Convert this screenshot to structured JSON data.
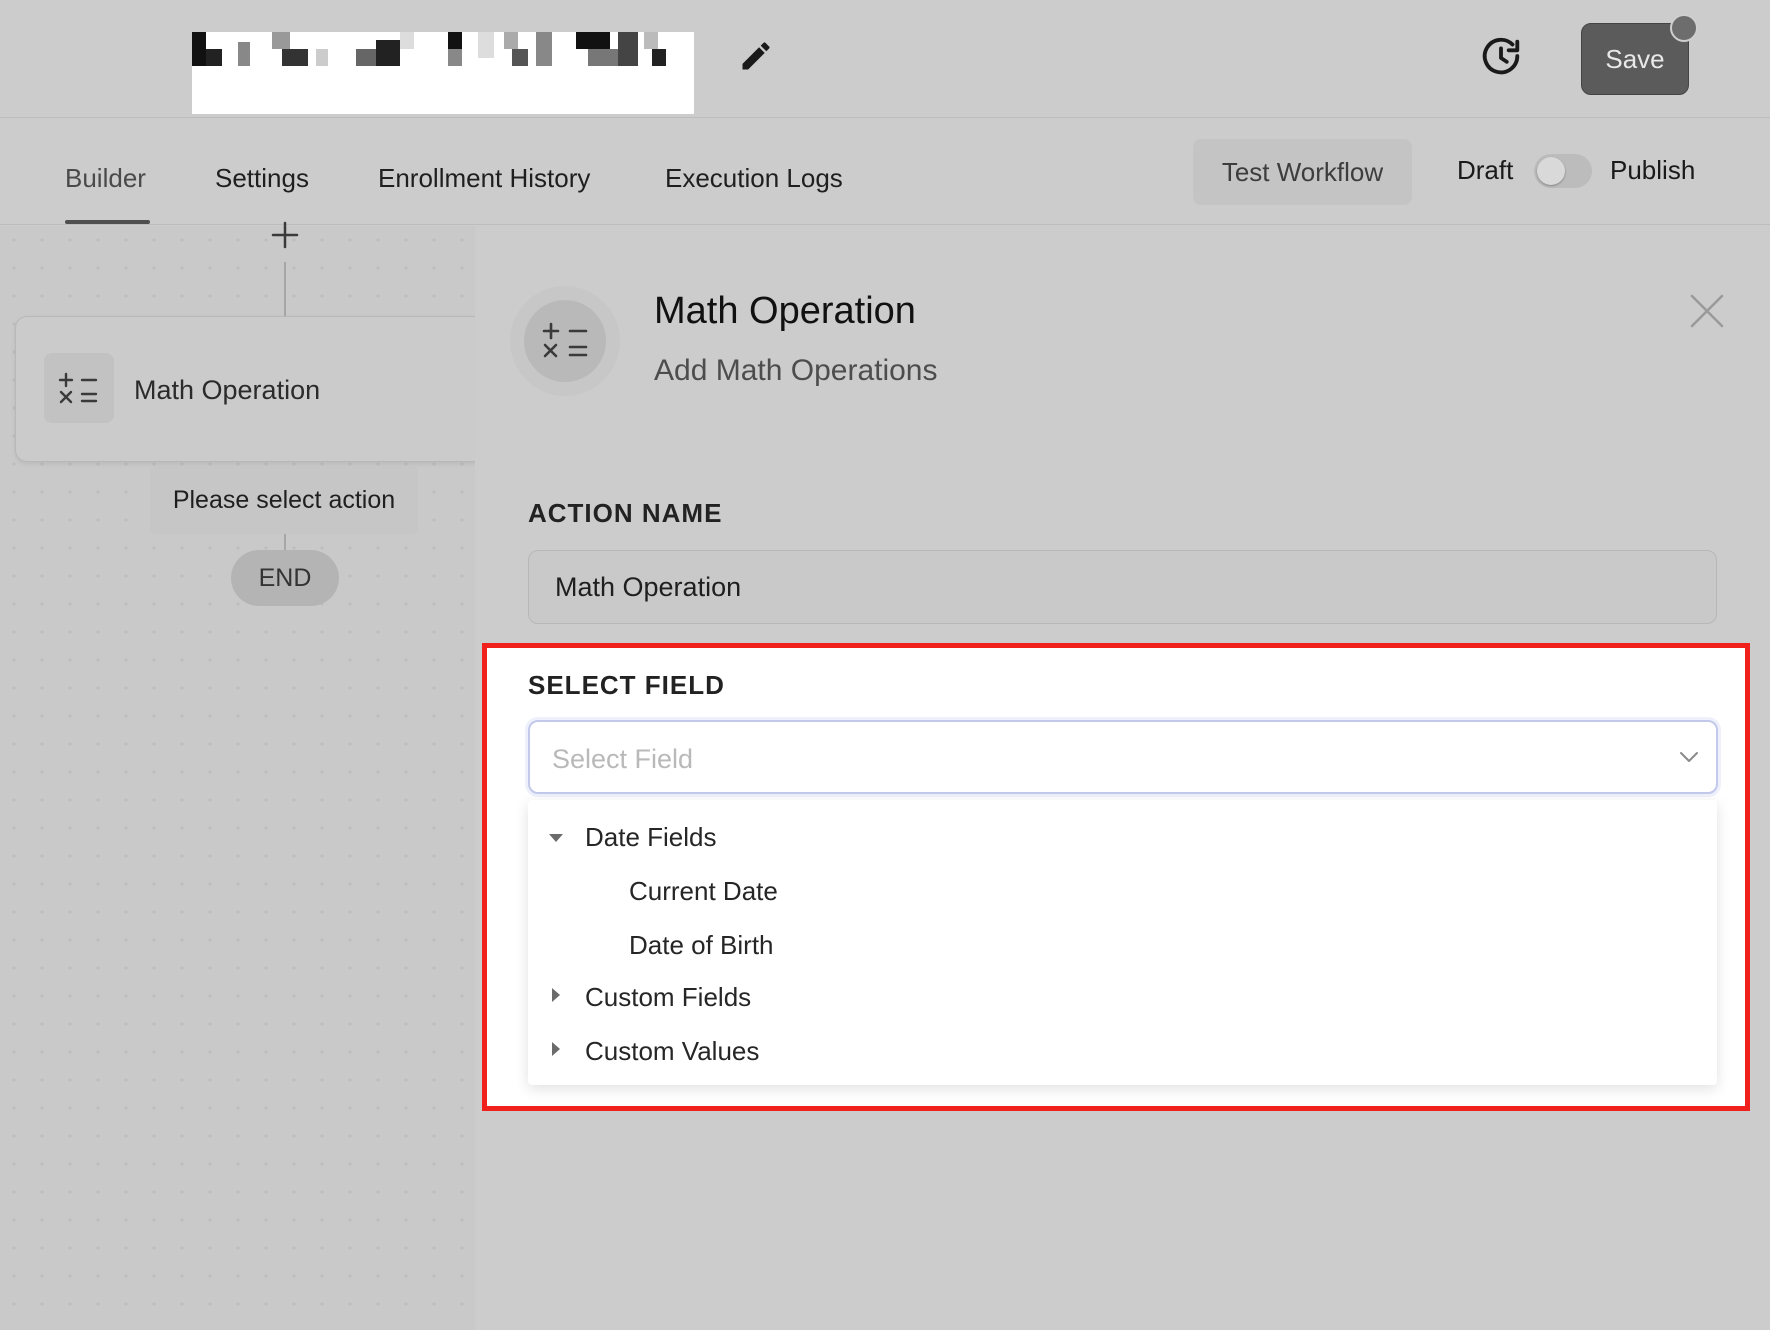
{
  "topbar": {
    "save_label": "Save"
  },
  "tabs": [
    {
      "label": "Builder",
      "active": true
    },
    {
      "label": "Settings",
      "active": false
    },
    {
      "label": "Enrollment History",
      "active": false
    },
    {
      "label": "Execution Logs",
      "active": false
    }
  ],
  "toolbar": {
    "test_workflow_label": "Test Workflow",
    "draft_label": "Draft",
    "publish_label": "Publish",
    "publish_toggle_on": false
  },
  "canvas": {
    "node_label": "Math Operation",
    "action_hint": "Please select action",
    "end_label": "END"
  },
  "panel": {
    "title": "Math Operation",
    "subtitle": "Add Math Operations",
    "action_name_label": "ACTION NAME",
    "action_name_value": "Math Operation",
    "select_field_label": "SELECT FIELD",
    "select_field_placeholder": "Select Field",
    "dropdown": {
      "groups": [
        {
          "label": "Date Fields",
          "expanded": true,
          "items": [
            "Current Date",
            "Date of Birth"
          ]
        },
        {
          "label": "Custom Fields",
          "expanded": false,
          "items": []
        },
        {
          "label": "Custom Values",
          "expanded": false,
          "items": []
        }
      ]
    }
  },
  "colors": {
    "highlight_border": "#f0201c",
    "select_focus_border": "#c3c9ea",
    "overlay_gray": "#cccccc",
    "save_button_bg": "#5b5b5b"
  }
}
